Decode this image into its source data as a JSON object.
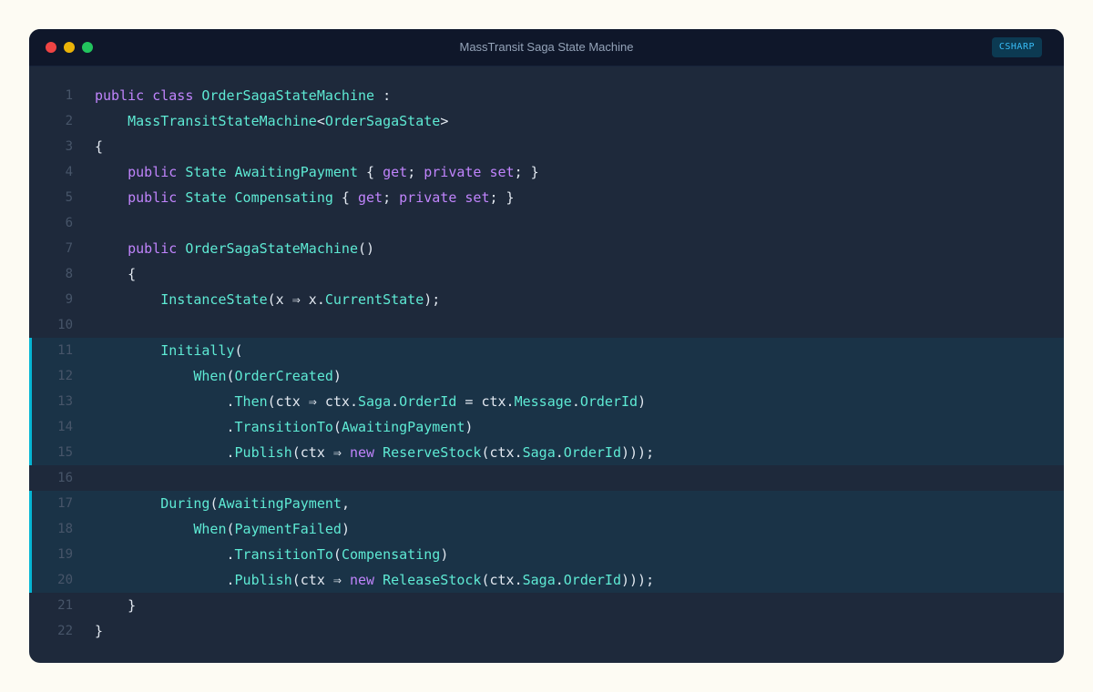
{
  "window": {
    "title": "MassTransit Saga State Machine",
    "language": "CSHARP"
  },
  "colors": {
    "keyword": "#c084fc",
    "type": "#5eead4",
    "text": "#e2e8f0",
    "highlight_bar": "#06b6d4"
  },
  "code": {
    "highlighted_lines": [
      11,
      12,
      13,
      14,
      15,
      17,
      18,
      19,
      20
    ],
    "lines": [
      {
        "n": "1",
        "tokens": [
          [
            "kw",
            "public"
          ],
          [
            "pl",
            " "
          ],
          [
            "kw",
            "class"
          ],
          [
            "pl",
            " "
          ],
          [
            "ty",
            "OrderSagaStateMachine"
          ],
          [
            "pl",
            " :"
          ]
        ]
      },
      {
        "n": "2",
        "tokens": [
          [
            "pl",
            "    "
          ],
          [
            "ty",
            "MassTransitStateMachine"
          ],
          [
            "pl",
            "<"
          ],
          [
            "ty",
            "OrderSagaState"
          ],
          [
            "pl",
            ">"
          ]
        ]
      },
      {
        "n": "3",
        "tokens": [
          [
            "pl",
            "{"
          ]
        ]
      },
      {
        "n": "4",
        "tokens": [
          [
            "pl",
            "    "
          ],
          [
            "kw",
            "public"
          ],
          [
            "pl",
            " "
          ],
          [
            "ty",
            "State"
          ],
          [
            "pl",
            " "
          ],
          [
            "ty",
            "AwaitingPayment"
          ],
          [
            "pl",
            " { "
          ],
          [
            "kw",
            "get"
          ],
          [
            "pl",
            "; "
          ],
          [
            "kw",
            "private"
          ],
          [
            "pl",
            " "
          ],
          [
            "kw",
            "set"
          ],
          [
            "pl",
            "; }"
          ]
        ]
      },
      {
        "n": "5",
        "tokens": [
          [
            "pl",
            "    "
          ],
          [
            "kw",
            "public"
          ],
          [
            "pl",
            " "
          ],
          [
            "ty",
            "State"
          ],
          [
            "pl",
            " "
          ],
          [
            "ty",
            "Compensating"
          ],
          [
            "pl",
            " { "
          ],
          [
            "kw",
            "get"
          ],
          [
            "pl",
            "; "
          ],
          [
            "kw",
            "private"
          ],
          [
            "pl",
            " "
          ],
          [
            "kw",
            "set"
          ],
          [
            "pl",
            "; }"
          ]
        ]
      },
      {
        "n": "6",
        "tokens": []
      },
      {
        "n": "7",
        "tokens": [
          [
            "pl",
            "    "
          ],
          [
            "kw",
            "public"
          ],
          [
            "pl",
            " "
          ],
          [
            "ty",
            "OrderSagaStateMachine"
          ],
          [
            "pl",
            "()"
          ]
        ]
      },
      {
        "n": "8",
        "tokens": [
          [
            "pl",
            "    {"
          ]
        ]
      },
      {
        "n": "9",
        "tokens": [
          [
            "pl",
            "        "
          ],
          [
            "ty",
            "InstanceState"
          ],
          [
            "pl",
            "(x ⇒ x."
          ],
          [
            "ty",
            "CurrentState"
          ],
          [
            "pl",
            ");"
          ]
        ]
      },
      {
        "n": "10",
        "tokens": []
      },
      {
        "n": "11",
        "tokens": [
          [
            "pl",
            "        "
          ],
          [
            "ty",
            "Initially"
          ],
          [
            "pl",
            "("
          ]
        ]
      },
      {
        "n": "12",
        "tokens": [
          [
            "pl",
            "            "
          ],
          [
            "ty",
            "When"
          ],
          [
            "pl",
            "("
          ],
          [
            "ty",
            "OrderCreated"
          ],
          [
            "pl",
            ")"
          ]
        ]
      },
      {
        "n": "13",
        "tokens": [
          [
            "pl",
            "                ."
          ],
          [
            "ty",
            "Then"
          ],
          [
            "pl",
            "(ctx ⇒ ctx."
          ],
          [
            "ty",
            "Saga"
          ],
          [
            "pl",
            "."
          ],
          [
            "ty",
            "OrderId"
          ],
          [
            "pl",
            " = ctx."
          ],
          [
            "ty",
            "Message"
          ],
          [
            "pl",
            "."
          ],
          [
            "ty",
            "OrderId"
          ],
          [
            "pl",
            ")"
          ]
        ]
      },
      {
        "n": "14",
        "tokens": [
          [
            "pl",
            "                ."
          ],
          [
            "ty",
            "TransitionTo"
          ],
          [
            "pl",
            "("
          ],
          [
            "ty",
            "AwaitingPayment"
          ],
          [
            "pl",
            ")"
          ]
        ]
      },
      {
        "n": "15",
        "tokens": [
          [
            "pl",
            "                ."
          ],
          [
            "ty",
            "Publish"
          ],
          [
            "pl",
            "(ctx ⇒ "
          ],
          [
            "kw",
            "new"
          ],
          [
            "pl",
            " "
          ],
          [
            "ty",
            "ReserveStock"
          ],
          [
            "pl",
            "(ctx."
          ],
          [
            "ty",
            "Saga"
          ],
          [
            "pl",
            "."
          ],
          [
            "ty",
            "OrderId"
          ],
          [
            "pl",
            ")));"
          ]
        ]
      },
      {
        "n": "16",
        "tokens": []
      },
      {
        "n": "17",
        "tokens": [
          [
            "pl",
            "        "
          ],
          [
            "ty",
            "During"
          ],
          [
            "pl",
            "("
          ],
          [
            "ty",
            "AwaitingPayment"
          ],
          [
            "pl",
            ","
          ]
        ]
      },
      {
        "n": "18",
        "tokens": [
          [
            "pl",
            "            "
          ],
          [
            "ty",
            "When"
          ],
          [
            "pl",
            "("
          ],
          [
            "ty",
            "PaymentFailed"
          ],
          [
            "pl",
            ")"
          ]
        ]
      },
      {
        "n": "19",
        "tokens": [
          [
            "pl",
            "                ."
          ],
          [
            "ty",
            "TransitionTo"
          ],
          [
            "pl",
            "("
          ],
          [
            "ty",
            "Compensating"
          ],
          [
            "pl",
            ")"
          ]
        ]
      },
      {
        "n": "20",
        "tokens": [
          [
            "pl",
            "                ."
          ],
          [
            "ty",
            "Publish"
          ],
          [
            "pl",
            "(ctx ⇒ "
          ],
          [
            "kw",
            "new"
          ],
          [
            "pl",
            " "
          ],
          [
            "ty",
            "ReleaseStock"
          ],
          [
            "pl",
            "(ctx."
          ],
          [
            "ty",
            "Saga"
          ],
          [
            "pl",
            "."
          ],
          [
            "ty",
            "OrderId"
          ],
          [
            "pl",
            ")));"
          ]
        ]
      },
      {
        "n": "21",
        "tokens": [
          [
            "pl",
            "    }"
          ]
        ]
      },
      {
        "n": "22",
        "tokens": [
          [
            "pl",
            "}"
          ]
        ]
      }
    ]
  }
}
